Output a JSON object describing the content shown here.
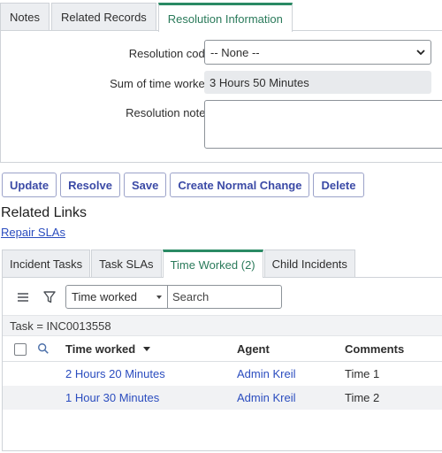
{
  "form_tabs": [
    "Notes",
    "Related Records",
    "Resolution Information"
  ],
  "form": {
    "resolution_code_label": "Resolution code",
    "resolution_code_value": "-- None --",
    "time_worked_label": "Sum of time worked",
    "time_worked_value": "3 Hours 50 Minutes",
    "resolution_notes_label": "Resolution notes",
    "resolution_notes_value": ""
  },
  "actions": [
    "Update",
    "Resolve",
    "Save",
    "Create Normal Change",
    "Delete"
  ],
  "related_links": {
    "title": "Related Links",
    "links": [
      "Repair SLAs"
    ]
  },
  "related_tabs": [
    "Incident Tasks",
    "Task SLAs",
    "Time Worked (2)",
    "Child Incidents"
  ],
  "list": {
    "filter_field": "Time worked",
    "search_placeholder": "Search",
    "breadcrumb": "Task = INC0013558",
    "columns": [
      "Time worked",
      "Agent",
      "Comments"
    ],
    "rows": [
      {
        "time_worked": "2 Hours 20 Minutes",
        "agent": "Admin Kreil",
        "comments": "Time 1"
      },
      {
        "time_worked": "1 Hour 30 Minutes",
        "agent": "Admin Kreil",
        "comments": "Time 2"
      }
    ]
  },
  "colors": {
    "active_tab_accent": "#2a8a64",
    "link": "#2b4dbf",
    "button_text": "#3b4aa6"
  },
  "icons": [
    "chevron-down-icon",
    "hamburger-menu-icon",
    "filter-funnel-icon",
    "search-icon",
    "sort-descending-icon"
  ]
}
